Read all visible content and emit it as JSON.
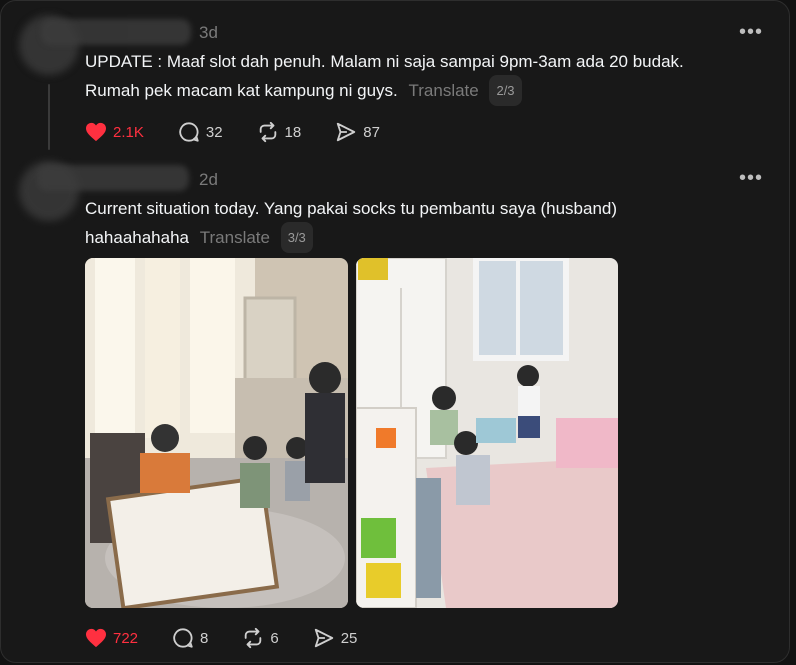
{
  "post1": {
    "time": "3d",
    "text_line1": "UPDATE : Maaf slot dah penuh. Malam ni saja sampai 9pm-3am ada 20 budak.",
    "text_line2": "Rumah pek macam kat kampung ni guys.",
    "translate": "Translate",
    "page": "2/3",
    "likes": "2.1K",
    "replies": "32",
    "reposts": "18",
    "shares": "87"
  },
  "post2": {
    "time": "2d",
    "text_line1": "Current situation today. Yang pakai socks tu pembantu saya (husband)",
    "text_line2": "hahaahahaha",
    "translate": "Translate",
    "page": "3/3",
    "likes": "722",
    "replies": "8",
    "reposts": "6",
    "shares": "25"
  },
  "icons": {
    "more": "more-icon",
    "like": "heart-icon",
    "reply": "comment-icon",
    "repost": "repost-icon",
    "share": "send-icon"
  },
  "colors": {
    "like": "#ff3040",
    "background": "#181818",
    "muted": "#7a7a7a"
  }
}
